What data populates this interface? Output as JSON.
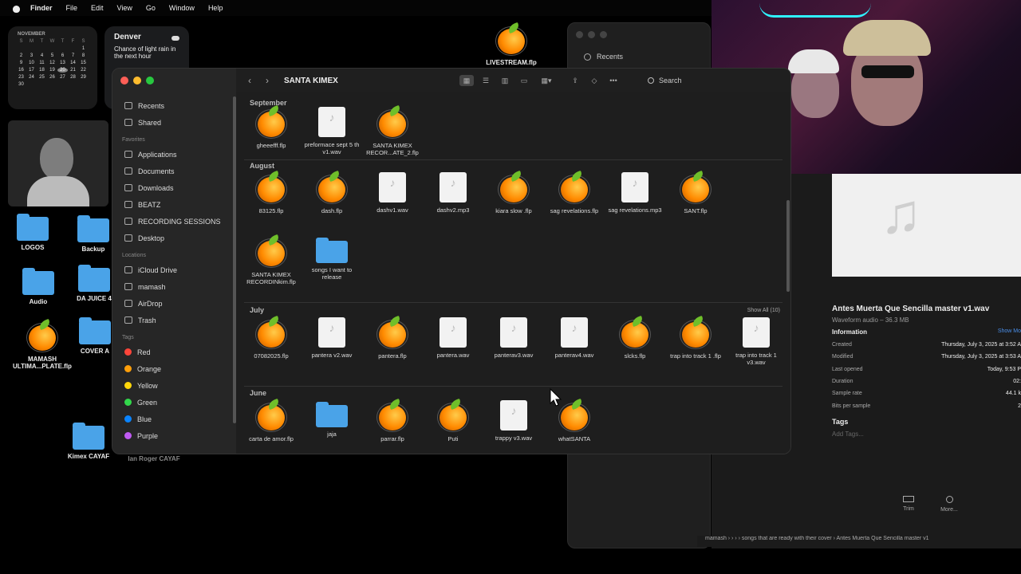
{
  "menubar": {
    "app": "Finder",
    "items": [
      "File",
      "Edit",
      "View",
      "Go",
      "Window",
      "Help"
    ]
  },
  "calendar": {
    "month": "NOVEMBER",
    "days_header": [
      "S",
      "M",
      "T",
      "W",
      "T",
      "F",
      "S"
    ],
    "weeks": [
      [
        "",
        "",
        "",
        "",
        "",
        "",
        "1"
      ],
      [
        "2",
        "3",
        "4",
        "5",
        "6",
        "7",
        "8"
      ],
      [
        "9",
        "10",
        "11",
        "12",
        "13",
        "14",
        "15"
      ],
      [
        "16",
        "17",
        "18",
        "19",
        "20",
        "21",
        "22"
      ],
      [
        "23",
        "24",
        "25",
        "26",
        "27",
        "28",
        "29"
      ],
      [
        "30",
        "",
        "",
        "",
        "",
        "",
        ""
      ]
    ],
    "today": "20"
  },
  "weather": {
    "city": "Denver",
    "forecast": "Chance of light rain in the next hour"
  },
  "desktop": {
    "logos": "LOGOS",
    "backup": "Backup",
    "audio": "Audio",
    "da_juice": "DA JUICE 4",
    "mamash": "MAMASH ULTIMA...PLATE.flp",
    "cover": "COVER A",
    "kimex": "Kimex CAYAF",
    "ian": "Ian Roger CAYAF",
    "livestream": "LIVESTREAM.flp"
  },
  "finder": {
    "title": "SANTA KIMEX",
    "search_label": "Search",
    "sidebar": {
      "top": [
        "Recents",
        "Shared"
      ],
      "favorites_heading": "Favorites",
      "favorites": [
        "Applications",
        "Documents",
        "Downloads",
        "BEATZ",
        "RECORDING SESSIONS",
        "Desktop"
      ],
      "locations_heading": "Locations",
      "locations": [
        "iCloud Drive",
        "mamash",
        "AirDrop",
        "Trash"
      ],
      "tags_heading": "Tags",
      "tags": [
        {
          "label": "Red",
          "color": "#ff453a"
        },
        {
          "label": "Orange",
          "color": "#ff9f0a"
        },
        {
          "label": "Yellow",
          "color": "#ffd60a"
        },
        {
          "label": "Green",
          "color": "#32d74b"
        },
        {
          "label": "Blue",
          "color": "#0a84ff"
        },
        {
          "label": "Purple",
          "color": "#bf5af2"
        }
      ]
    },
    "sections": {
      "september": {
        "title": "September",
        "files": [
          {
            "name": "gheeefff.flp",
            "type": "flp"
          },
          {
            "name": "preformace sept 5 th v1.wav",
            "type": "wav"
          },
          {
            "name": "SANTA KIMEX RECOR...ATE_2.flp",
            "type": "flp"
          }
        ]
      },
      "august": {
        "title": "August",
        "files": [
          {
            "name": "83125.flp",
            "type": "flp"
          },
          {
            "name": "dash.flp",
            "type": "flp"
          },
          {
            "name": "dashv1.wav",
            "type": "wav"
          },
          {
            "name": "dashv2.mp3",
            "type": "wav"
          },
          {
            "name": "kiara slow .flp",
            "type": "flp"
          },
          {
            "name": "sag revelations.flp",
            "type": "flp"
          },
          {
            "name": "sag revelations.mp3",
            "type": "wav"
          },
          {
            "name": "SANT.flp",
            "type": "flp"
          },
          {
            "name": "SANTA KIMEX RECORDINkim.flp",
            "type": "flp"
          },
          {
            "name": "songs I want to release",
            "type": "folder"
          }
        ]
      },
      "july": {
        "title": "July",
        "show_all": "Show All (10)",
        "files": [
          {
            "name": "07082025.flp",
            "type": "flp"
          },
          {
            "name": "pantera v2.wav",
            "type": "wav"
          },
          {
            "name": "pantera.flp",
            "type": "flp"
          },
          {
            "name": "pantera.wav",
            "type": "wav"
          },
          {
            "name": "panterav3.wav",
            "type": "wav"
          },
          {
            "name": "panterav4.wav",
            "type": "wav"
          },
          {
            "name": "slcks.flp",
            "type": "flp"
          },
          {
            "name": "trap into track 1 .flp",
            "type": "flp"
          },
          {
            "name": "trap into track 1 v3.wav",
            "type": "wav"
          }
        ]
      },
      "june": {
        "title": "June",
        "files": [
          {
            "name": "carta de amor.flp",
            "type": "flp"
          },
          {
            "name": "jaja",
            "type": "folder"
          },
          {
            "name": "parrar.flp",
            "type": "flp"
          },
          {
            "name": "Puti",
            "type": "flp"
          },
          {
            "name": "trappy v3.wav",
            "type": "wav"
          },
          {
            "name": "whatSANTA",
            "type": "flp"
          }
        ]
      }
    }
  },
  "background_window": {
    "recents": "Recents"
  },
  "preview": {
    "filename": "Antes Muerta Que Sencilla master v1.wav",
    "subtitle": "Waveform audio – 36.3 MB",
    "info_heading": "Information",
    "show_more": "Show Mo",
    "rows": [
      {
        "label": "Created",
        "value": "Thursday, July 3, 2025 at 3:52 A"
      },
      {
        "label": "Modified",
        "value": "Thursday, July 3, 2025 at 3:53 A"
      },
      {
        "label": "Last opened",
        "value": "Today, 9:53 P"
      },
      {
        "label": "Duration",
        "value": "02:"
      },
      {
        "label": "Sample rate",
        "value": "44.1 k"
      },
      {
        "label": "Bits per sample",
        "value": "2"
      }
    ],
    "tags_heading": "Tags",
    "add_tags": "Add Tags...",
    "trim": "Trim",
    "more": "More...",
    "pathbar": "mamash ›  ›  ›  › songs that are ready with their cover › Antes Muerta Que Sencilla master v1"
  }
}
